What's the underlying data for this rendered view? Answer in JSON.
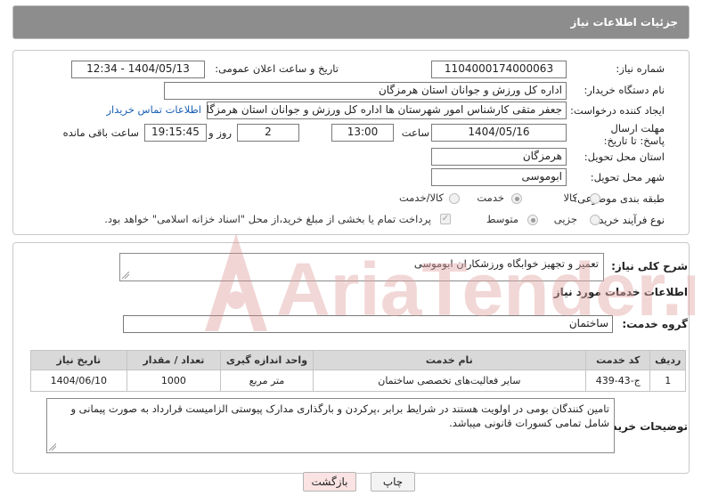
{
  "header": {
    "title": "جزئیات اطلاعات نیاز"
  },
  "fields": {
    "need_number": {
      "label": "شماره نیاز:",
      "value": "1104000174000063"
    },
    "announce_datetime": {
      "label": "تاریخ و ساعت اعلان عمومی:",
      "value": "1404/05/13 - 12:34"
    },
    "buyer_org": {
      "label": "نام دستگاه خریدار:",
      "value": "اداره کل ورزش و جوانان استان هرمزگان"
    },
    "requester": {
      "label": "ایجاد کننده درخواست:",
      "value": "جعفر متقی کارشناس امور شهرستان ها اداره کل ورزش و جوانان استان هرمزگان"
    },
    "buyer_contact_link": "اطلاعات تماس خریدار",
    "deadline": {
      "label": "مهلت ارسال پاسخ: تا تاریخ:",
      "date": "1404/05/16",
      "time_label": "ساعت",
      "time": "13:00",
      "days": "2",
      "days_label": "روز و",
      "remaining": "19:15:45",
      "remaining_label": "ساعت باقی مانده"
    },
    "delivery_province": {
      "label": "استان محل تحویل:",
      "value": "هرمزگان"
    },
    "delivery_city": {
      "label": "شهر محل تحویل:",
      "value": "ابوموسی"
    },
    "category": {
      "label": "طبقه بندی موضوعی:",
      "options": [
        "کالا",
        "خدمت",
        "کالا/خدمت"
      ],
      "selected": "خدمت"
    },
    "purchase_type": {
      "label": "نوع فرآیند خرید :",
      "options": [
        "جزیی",
        "متوسط"
      ],
      "selected": "متوسط",
      "payment_note": "پرداخت تمام یا بخشی از مبلغ خرید،از محل \"اسناد خزانه اسلامی\" خواهد بود."
    }
  },
  "summary": {
    "label": "شرح کلی نیاز:",
    "value": "تعمیر و تجهیز خوابگاه ورزشکاران ابوموسی"
  },
  "services": {
    "section_title": "اطلاعات خدمات مورد نیاز",
    "group_label": "گروه خدمت:",
    "group_value": "ساختمان",
    "columns": [
      "ردیف",
      "کد خدمت",
      "نام خدمت",
      "واحد اندازه گیری",
      "تعداد / مقدار",
      "تاریخ نیاز"
    ],
    "rows": [
      [
        "1",
        "ج-43-439",
        "سایر فعالیت‌های تخصصی ساختمان",
        "متر مربع",
        "1000",
        "1404/06/10"
      ]
    ]
  },
  "buyer_notes": {
    "label": "توضیحات خریدار:",
    "value": "تامین کنندگان بومی در اولویت هستند در شرایط برابر ،پرکردن و بارگذاری مدارک پیوستی  الزامیست قرارداد به صورت پیمانی و شامل تمامی کسورات قانونی میباشد."
  },
  "buttons": {
    "print": "چاپ",
    "back": "بازگشت"
  },
  "watermark": {
    "text": "AriaTender.neT"
  },
  "colors": {
    "header": "#8d8d8d",
    "link": "#1a5fb4",
    "back_button": "#fbe3e3",
    "watermark": "#e4a8a8"
  }
}
